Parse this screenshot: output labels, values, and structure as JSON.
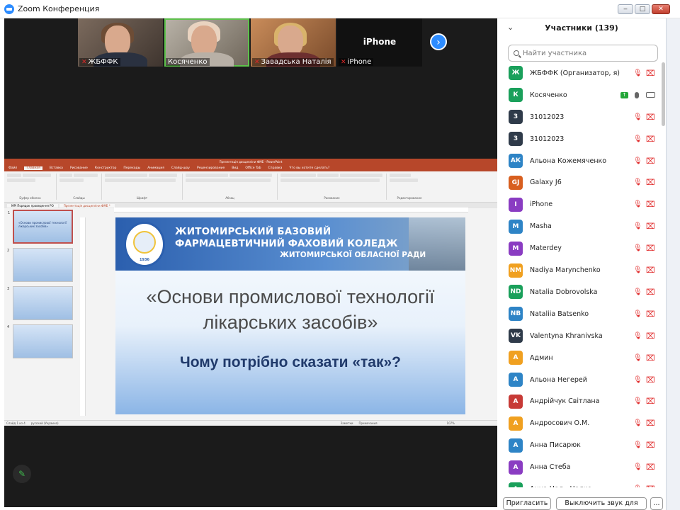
{
  "window": {
    "title": "Zoom Конференция",
    "controls": [
      "‒",
      "□",
      "✕"
    ]
  },
  "videos": [
    {
      "name": "ЖБФФК",
      "muted": true
    },
    {
      "name": "Косяченко",
      "muted": false,
      "active_speaker": true
    },
    {
      "name": "Завадська Наталія",
      "muted": true
    },
    {
      "name": "iPhone",
      "muted": true,
      "label_center": "iPhone"
    }
  ],
  "shared_screen": {
    "ppt_window_title": "Презентація дисципліни ФМБ - PowerPoint",
    "ppt_tabs": [
      "Файл",
      "Главная",
      "Вставка",
      "Рисование",
      "Конструктор",
      "Переходы",
      "Анимация",
      "Слайд-шоу",
      "Рецензирование",
      "Вид",
      "Office Tab",
      "Справка",
      "Что вы хотите сделать?"
    ],
    "active_tab": "Главная",
    "doc_tabs": [
      "MPI Порядок проведення РО",
      "Презентація дисципліни ФМБ *"
    ],
    "ribbon_groups": [
      "Буфер обмена",
      "Слайды",
      "Шрифт",
      "Абзац",
      "Рисование",
      "Редактирование"
    ],
    "thumbnails": [
      {
        "num": "1",
        "text": "«Основи промислової технології лікарських засобів»",
        "selected": true
      },
      {
        "num": "2",
        "text": ""
      },
      {
        "num": "3",
        "text": ""
      },
      {
        "num": "4",
        "text": ""
      }
    ],
    "slide": {
      "college_line1": "ЖИТОМИРСЬКИЙ БАЗОВИЙ",
      "college_line2": "ФАРМАЦЕВТИЧНИЙ ФАХОВИЙ КОЛЕДЖ",
      "college_line3": "ЖИТОМИРСЬКОЇ ОБЛАСНОЇ РАДИ",
      "emblem_year": "1936",
      "title": "«Основи промислової технології лікарських засобів»",
      "question": "Чому потрібно сказати «так»?"
    },
    "status": {
      "slide_count": "Слайд 1 из 4",
      "language": "русский (Украина)",
      "notes": "Заметки",
      "comments": "Примечания",
      "zoom": "107%"
    }
  },
  "participants": {
    "title": "Участники (139)",
    "search_placeholder": "Найти участника",
    "list": [
      {
        "initials": "Ж",
        "name": "ЖБФФК (Организатор, я)",
        "color": "#1aa05b",
        "mic": "off",
        "cam": "off"
      },
      {
        "initials": "К",
        "name": "Косяченко",
        "color": "#1aa05b",
        "mic": "on",
        "cam": "on",
        "sharing": true
      },
      {
        "initials": "3",
        "name": "31012023",
        "color": "#2f3b4a",
        "mic": "off",
        "cam": "off"
      },
      {
        "initials": "3",
        "name": "31012023",
        "color": "#2f3b4a",
        "mic": "off",
        "cam": "off"
      },
      {
        "initials": "АК",
        "name": "Альона Кожемяченко",
        "color": "#2e84c6",
        "mic": "off",
        "cam": "off"
      },
      {
        "initials": "GJ",
        "name": "Galaxy J6",
        "color": "#d85f1f",
        "mic": "off",
        "cam": "off"
      },
      {
        "initials": "I",
        "name": "iPhone",
        "color": "#8a3cc2",
        "mic": "off",
        "cam": "off"
      },
      {
        "initials": "M",
        "name": "Masha",
        "color": "#2e84c6",
        "mic": "off",
        "cam": "off"
      },
      {
        "initials": "M",
        "name": "Materdey",
        "color": "#8a3cc2",
        "mic": "off",
        "cam": "off"
      },
      {
        "initials": "NM",
        "name": "Nadiya Marynchenko",
        "color": "#f0a020",
        "mic": "off",
        "cam": "off"
      },
      {
        "initials": "ND",
        "name": "Natalia Dobrovolska",
        "color": "#1aa05b",
        "mic": "off",
        "cam": "off"
      },
      {
        "initials": "NB",
        "name": "Nataliia Batsenko",
        "color": "#2e84c6",
        "mic": "off",
        "cam": "off"
      },
      {
        "initials": "VK",
        "name": "Valentyna Khranivska",
        "color": "#2f3b4a",
        "mic": "off",
        "cam": "off"
      },
      {
        "initials": "А",
        "name": "Админ",
        "color": "#f0a020",
        "mic": "off",
        "cam": "off"
      },
      {
        "initials": "А",
        "name": "Альона Негерей",
        "color": "#2e84c6",
        "mic": "off",
        "cam": "off"
      },
      {
        "initials": "А",
        "name": "Андрійчук Світлана",
        "color": "#c73a36",
        "mic": "off",
        "cam": "off"
      },
      {
        "initials": "А",
        "name": "Андросович О.М.",
        "color": "#f0a020",
        "mic": "off",
        "cam": "off"
      },
      {
        "initials": "А",
        "name": "Анна Писарюк",
        "color": "#2e84c6",
        "mic": "off",
        "cam": "off"
      },
      {
        "initials": "А",
        "name": "Анна Стеба",
        "color": "#8a3cc2",
        "mic": "off",
        "cam": "off"
      },
      {
        "initials": "А",
        "name": "Анна Цал - Цалко",
        "color": "#1aa05b",
        "mic": "off",
        "cam": "off"
      }
    ],
    "footer": {
      "invite": "Пригласить",
      "mute_all": "Выключить звук для всех",
      "more": "..."
    }
  }
}
